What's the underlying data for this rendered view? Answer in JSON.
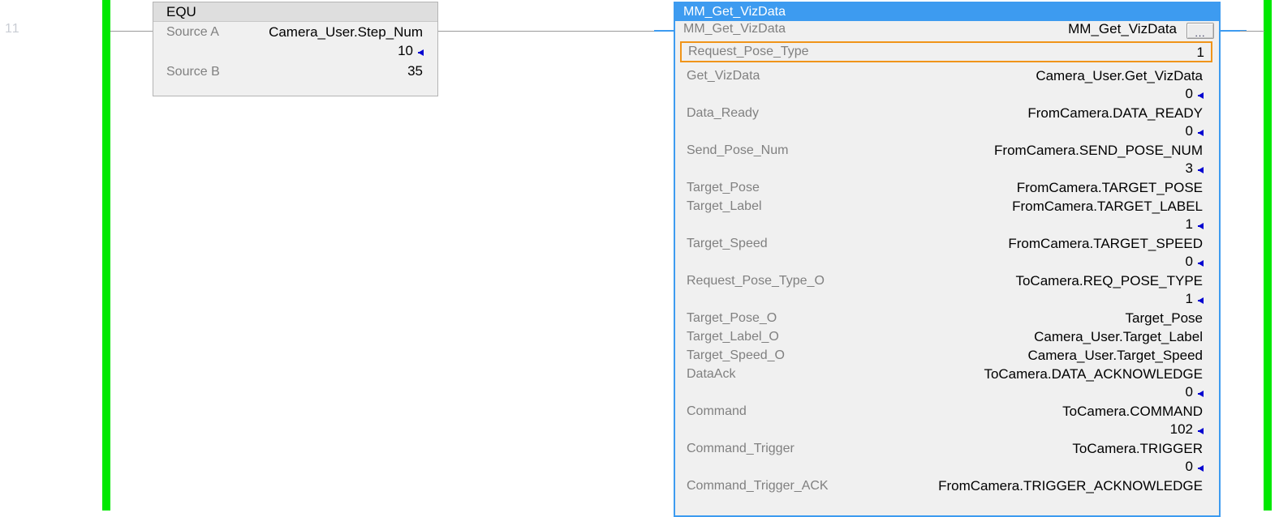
{
  "rung": {
    "number": "11"
  },
  "colors": {
    "rail": "#00e800",
    "block_header": "#3d9bf0",
    "selection": "#f09419",
    "value_arrow": "#0000d0",
    "param_name": "#808080",
    "tag_text": "#000000"
  },
  "equ_block": {
    "name": "EQU",
    "header_label": "EQU",
    "rows": [
      {
        "operand": "Source A",
        "tag": "Camera_User.Step_Num",
        "value": "10",
        "has_arrow": true
      },
      {
        "operand": "Source B",
        "tag": "",
        "value": "35",
        "has_arrow": false
      }
    ]
  },
  "aoi_block": {
    "title": "MM_Get_VizData",
    "instance_label": "MM_Get_VizData",
    "instance_tag": "MM_Get_VizData",
    "ellipsis_button_label": "...",
    "selected_param": {
      "name": "Request_Pose_Type",
      "value": "1"
    },
    "parameters": [
      {
        "name": "Get_VizData",
        "tag": "Camera_User.Get_VizData",
        "value": "0",
        "has_value": true,
        "gap_before": true
      },
      {
        "name": "Data_Ready",
        "tag": "FromCamera.DATA_READY",
        "value": "0",
        "has_value": true,
        "gap_before": false
      },
      {
        "name": "Send_Pose_Num",
        "tag": "FromCamera.SEND_POSE_NUM",
        "value": "3",
        "has_value": true,
        "gap_before": false
      },
      {
        "name": "Target_Pose",
        "tag": "FromCamera.TARGET_POSE",
        "value": "",
        "has_value": false,
        "gap_before": false
      },
      {
        "name": "Target_Label",
        "tag": "FromCamera.TARGET_LABEL",
        "value": "1",
        "has_value": true,
        "gap_before": false
      },
      {
        "name": "Target_Speed",
        "tag": "FromCamera.TARGET_SPEED",
        "value": "0",
        "has_value": true,
        "gap_before": false
      },
      {
        "name": "Request_Pose_Type_O",
        "tag": "ToCamera.REQ_POSE_TYPE",
        "value": "1",
        "has_value": true,
        "gap_before": false
      },
      {
        "name": "Target_Pose_O",
        "tag": "Target_Pose",
        "value": "",
        "has_value": false,
        "gap_before": false
      },
      {
        "name": "Target_Label_O",
        "tag": "Camera_User.Target_Label",
        "value": "",
        "has_value": false,
        "gap_before": false
      },
      {
        "name": "Target_Speed_O",
        "tag": "Camera_User.Target_Speed",
        "value": "",
        "has_value": false,
        "gap_before": false
      },
      {
        "name": "DataAck",
        "tag": "ToCamera.DATA_ACKNOWLEDGE",
        "value": "0",
        "has_value": true,
        "gap_before": false
      },
      {
        "name": "Command",
        "tag": "ToCamera.COMMAND",
        "value": "102",
        "has_value": true,
        "gap_before": false
      },
      {
        "name": "Command_Trigger",
        "tag": "ToCamera.TRIGGER",
        "value": "0",
        "has_value": true,
        "gap_before": false
      },
      {
        "name": "Command_Trigger_ACK",
        "tag": "FromCamera.TRIGGER_ACKNOWLEDGE",
        "value": "",
        "has_value": false,
        "gap_before": false
      }
    ]
  }
}
